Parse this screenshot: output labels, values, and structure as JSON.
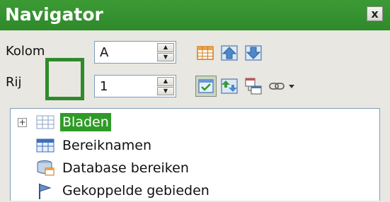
{
  "window": {
    "title": "Navigator",
    "close_glyph": "x"
  },
  "fields": {
    "column_label": "Kolom",
    "column_value": "A",
    "row_label": "Rij",
    "row_value": "1"
  },
  "toolbar": {
    "buttons": [
      {
        "icon": "data-range-icon"
      },
      {
        "icon": "start-icon"
      },
      {
        "icon": "end-icon"
      },
      {
        "icon": "toggle-content-icon",
        "active": true
      },
      {
        "icon": "scenarios-icon"
      },
      {
        "icon": "drag-mode-icon"
      },
      {
        "icon": "link-dropdown-icon"
      }
    ]
  },
  "tree": {
    "items": [
      {
        "label": "Bladen",
        "icon": "sheets-icon",
        "selected": true,
        "expandable": true
      },
      {
        "label": "Bereiknamen",
        "icon": "range-names-icon"
      },
      {
        "label": "Database bereiken",
        "icon": "database-icon"
      },
      {
        "label": "Gekoppelde gebieden",
        "icon": "flag-icon"
      }
    ]
  },
  "colors": {
    "accent": "#2f8a2a",
    "selection": "#2f9a28",
    "background": "#e8e7e2"
  }
}
